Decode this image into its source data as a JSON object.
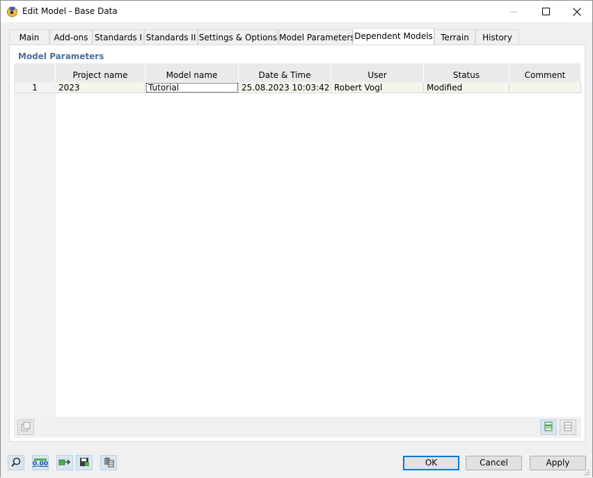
{
  "window": {
    "title": "Edit Model - Base Data"
  },
  "tabs": [
    {
      "label": "Main"
    },
    {
      "label": "Add-ons"
    },
    {
      "label": "Standards I"
    },
    {
      "label": "Standards II"
    },
    {
      "label": "Settings & Options"
    },
    {
      "label": "Model Parameters"
    },
    {
      "label": "Dependent Models",
      "active": true
    },
    {
      "label": "Terrain"
    },
    {
      "label": "History"
    }
  ],
  "section": {
    "title": "Model Parameters"
  },
  "table": {
    "columns": [
      "Project name",
      "Model name",
      "Date & Time",
      "User",
      "Status",
      "Comment"
    ],
    "rows": [
      {
        "num": "1",
        "project": "2023",
        "model": "Tutorial",
        "datetime": "25.08.2023 10:03:42",
        "user": "Robert Vogl",
        "status": "Modified",
        "comment": ""
      }
    ]
  },
  "buttons": {
    "ok": "OK",
    "cancel": "Cancel",
    "apply": "Apply"
  },
  "toolbar": {
    "units_label": "0,00"
  },
  "icons": {
    "app": "rfem-app-icon",
    "search": "search-icon",
    "units": "decimal-units-icon",
    "transfer": "model-transfer-icon",
    "save_settings": "save-settings-icon",
    "table": "table-icon",
    "copy": "copy-icon",
    "export": "export-excel-icon",
    "import": "import-icon"
  },
  "colors": {
    "section_title": "#4e6f9a",
    "row_bg": "#f4f6ec",
    "default_button_border": "#0078d7"
  }
}
